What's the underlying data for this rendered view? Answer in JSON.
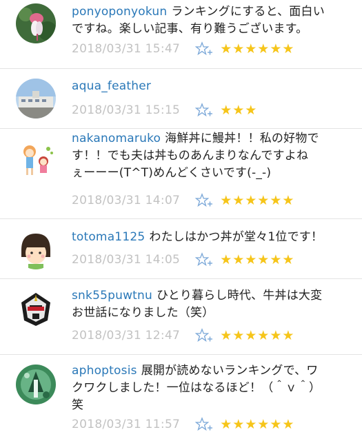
{
  "comments": [
    {
      "username": "ponyoponyokun",
      "lines": [
        "ランキングにすると、面白い",
        "ですね。楽しい記事、有り難うございます。"
      ],
      "timestamp": "2018/03/31 15:47",
      "stars": "★★★★★★",
      "star_count": 6,
      "avatar_icon": "flower-avatar-icon"
    },
    {
      "username": "aqua_feather",
      "lines": [
        ""
      ],
      "timestamp": "2018/03/31 15:15",
      "stars": "★★★",
      "star_count": 3,
      "avatar_icon": "building-photo-avatar-icon"
    },
    {
      "username": "nakanomaruko",
      "lines": [
        "海鮮丼に鰻丼！！私の好物で",
        "す！！でも夫は丼ものあんまりなんですよね",
        "ぇーーー(T^T)めんどくさいです(-_-)"
      ],
      "timestamp": "2018/03/31 14:07",
      "stars": "★★★★★★",
      "star_count": 6,
      "avatar_icon": "kids-illustration-avatar-icon"
    },
    {
      "username": "totoma1125",
      "lines": [
        "わたしはかつ丼が堂々1位です！"
      ],
      "timestamp": "2018/03/31 14:05",
      "stars": "★★★★★★",
      "star_count": 6,
      "avatar_icon": "girl-face-avatar-icon"
    },
    {
      "username": "snk55puwtnu",
      "lines": [
        "ひとり暮らし時代、牛丼は大変",
        "お世話になりました（笑）"
      ],
      "timestamp": "2018/03/31 12:47",
      "stars": "★★★★★★",
      "star_count": 6,
      "avatar_icon": "robot-head-avatar-icon"
    },
    {
      "username": "aphoptosis",
      "lines": [
        "展開が読めないランキングで、ワ",
        "クワクしました！一位はなるほど！（＾ｖ＾）",
        "笑"
      ],
      "timestamp": "2018/03/31 11:57",
      "stars": "★★★★★★",
      "star_count": 6,
      "avatar_icon": "green-character-avatar-icon"
    }
  ],
  "colors": {
    "username": "#2a78b8",
    "text": "#222222",
    "timestamp": "#c2c2c2",
    "star": "#f6c51a",
    "add_star_icon": "#7aa7d8",
    "divider": "#e3e3e3"
  }
}
